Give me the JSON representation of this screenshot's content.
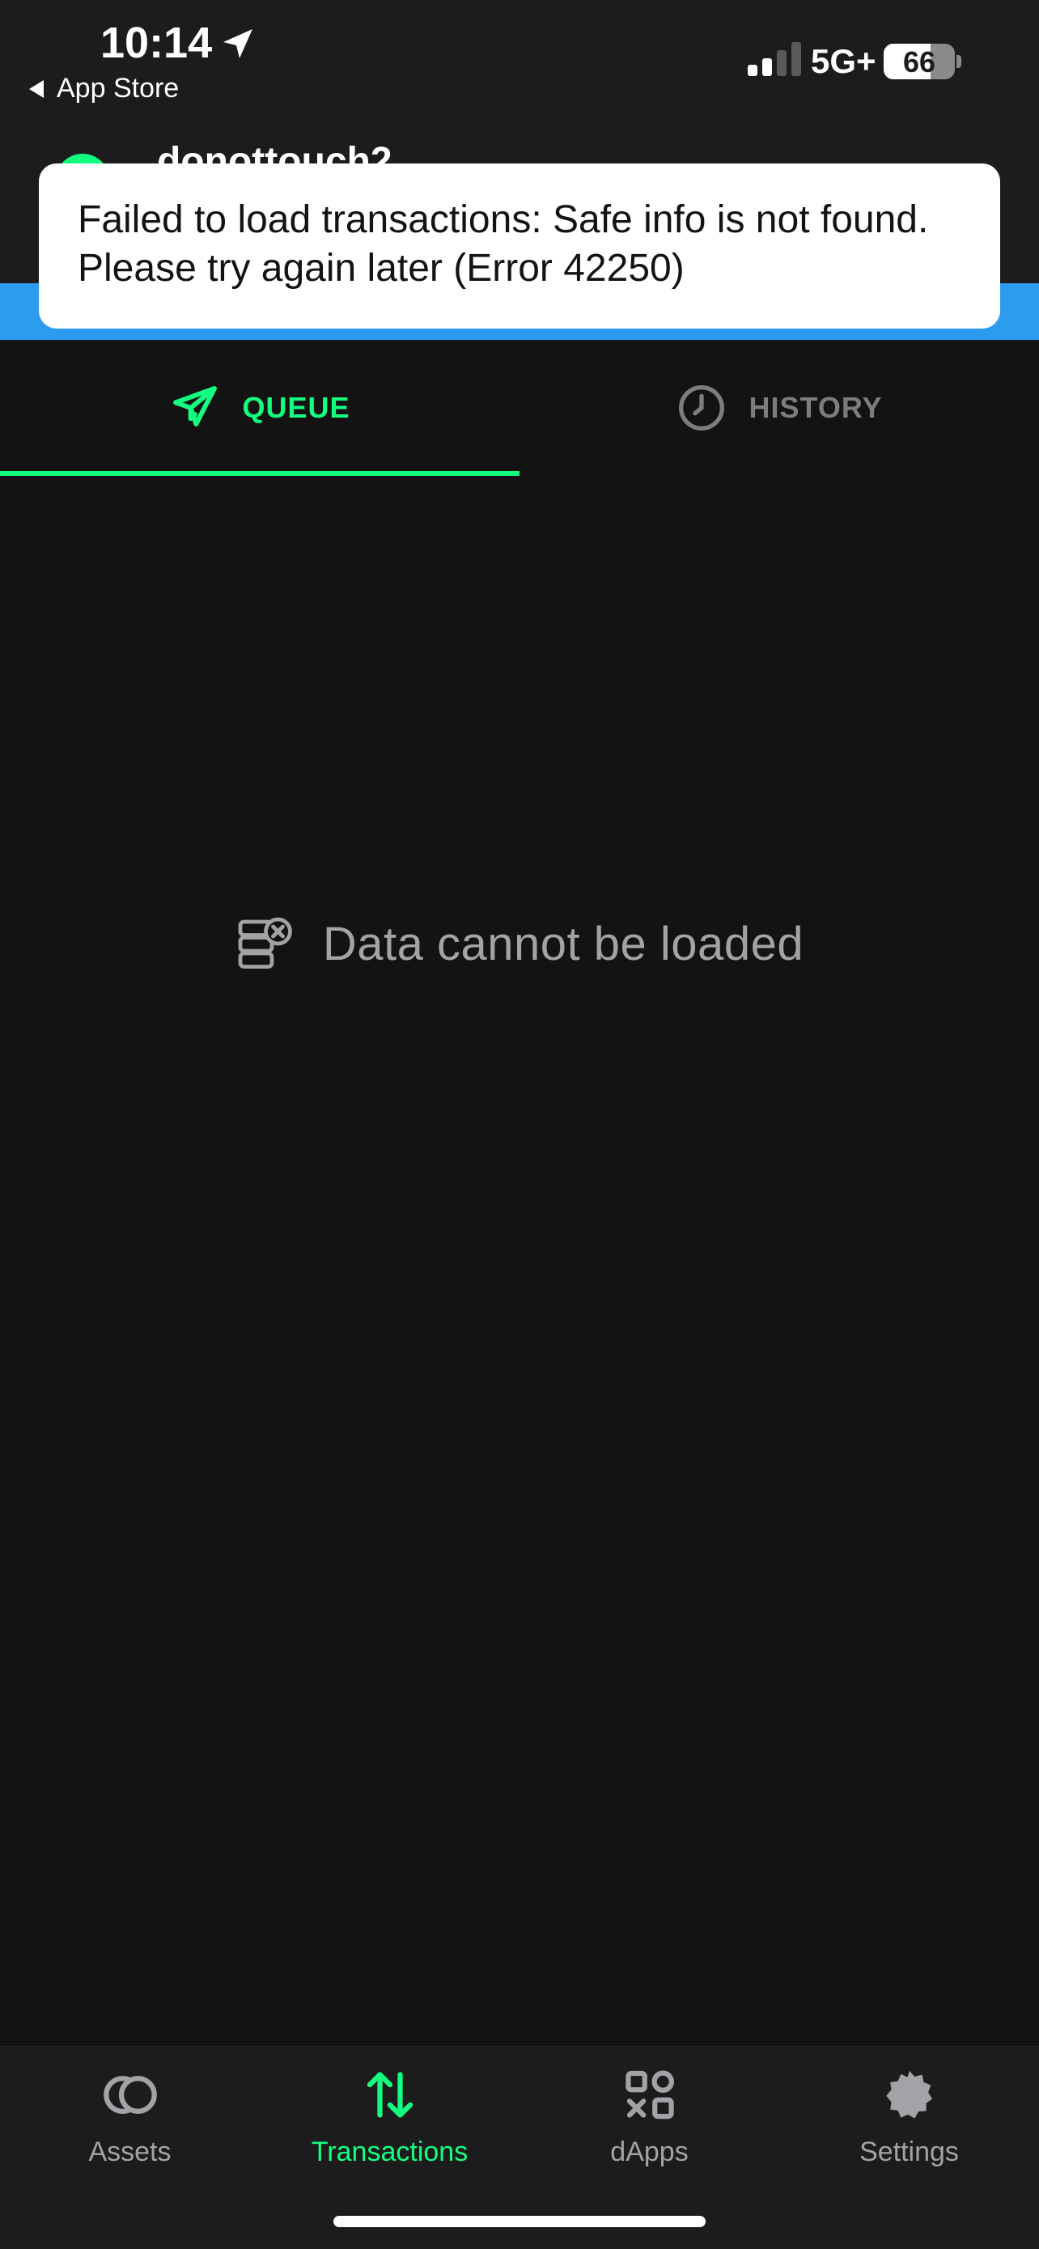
{
  "status_bar": {
    "time": "10:14",
    "back_label": "App Store",
    "network": "5G+",
    "battery": "66",
    "battery_level": 0.66
  },
  "header": {
    "safe_name": "donottouch2"
  },
  "toast": {
    "message": "Failed to load transactions: Safe info is not found. Please try again later (Error 42250)"
  },
  "tabs": [
    {
      "label": "QUEUE",
      "icon": "paper-plane-icon",
      "active": true
    },
    {
      "label": "HISTORY",
      "icon": "clock-icon",
      "active": false
    }
  ],
  "empty_state": {
    "icon": "database-error-icon",
    "text": "Data cannot be loaded"
  },
  "bottom_nav": [
    {
      "label": "Assets",
      "icon": "coins-icon",
      "active": false
    },
    {
      "label": "Transactions",
      "icon": "transfer-arrows-icon",
      "active": true
    },
    {
      "label": "dApps",
      "icon": "apps-grid-icon",
      "active": false
    },
    {
      "label": "Settings",
      "icon": "gear-icon",
      "active": false
    }
  ],
  "colors": {
    "accent": "#12ff80",
    "background": "#121312",
    "surface": "#1c1c1c",
    "banner": "#2d9cf0",
    "muted": "#a1a3a7"
  }
}
